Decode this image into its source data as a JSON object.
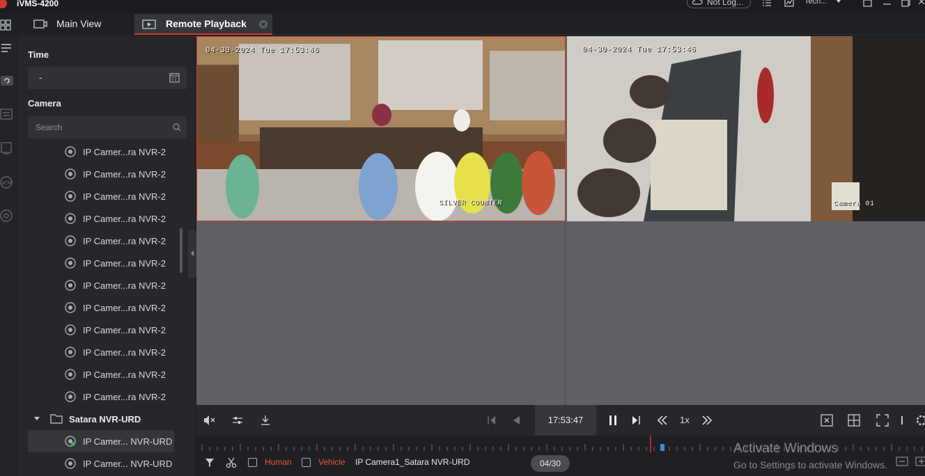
{
  "window": {
    "title": "iVMS-4200",
    "account": "Not Log...",
    "user": "Tech..."
  },
  "tabs": [
    {
      "label": "Main View",
      "icon": "monitor-icon"
    },
    {
      "label": "Remote Playback",
      "icon": "playback-icon"
    }
  ],
  "panel": {
    "time_title": "Time",
    "date_value": "-",
    "camera_title": "Camera",
    "search_placeholder": "Search",
    "cameras": [
      "IP Camer...ra NVR-2",
      "IP Camer...ra NVR-2",
      "IP Camer...ra NVR-2",
      "IP Camer...ra NVR-2",
      "IP Camer...ra NVR-2",
      "IP Camer...ra NVR-2",
      "IP Camer...ra NVR-2",
      "IP Camer...ra NVR-2",
      "IP Camer...ra NVR-2",
      "IP Camer...ra NVR-2",
      "IP Camer...ra NVR-2",
      "IP Camer...ra NVR-2"
    ],
    "group": "Satara NVR-URD",
    "group_cameras": [
      "IP Camer... NVR-URD",
      "IP Camer... NVR-URD"
    ]
  },
  "video": {
    "tile1": {
      "timestamp": "04-30-2024 Tue 17:53:46",
      "label": "SILVER COUNTER"
    },
    "tile2": {
      "timestamp": "04-30-2024 Tue 17:53:46",
      "label": "Camera 01"
    }
  },
  "controls": {
    "time": "17:53:47",
    "speed": "1x"
  },
  "filter": {
    "human_label": "Human",
    "vehicle_label": "Vehicle",
    "camera_name": "IP Camera1_Satara NVR-URD",
    "date": "04/30",
    "accent": "#e0533f"
  },
  "watermark": {
    "line1": "Activate Windows",
    "line2": "Go to Settings to activate Windows."
  }
}
